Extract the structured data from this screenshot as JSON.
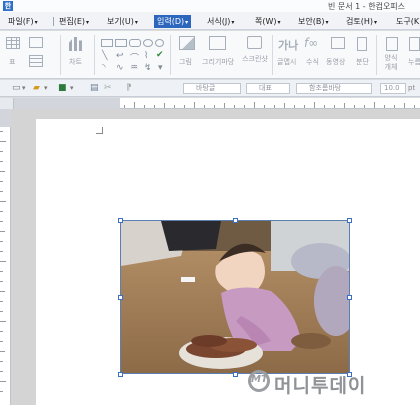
{
  "window": {
    "app_icon_glyph": "한",
    "title": "빈 문서 1 - 한컴오피스"
  },
  "menu": [
    {
      "label": "파일(F)",
      "active": false
    },
    {
      "label": "편집(E)",
      "active": false
    },
    {
      "label": "보기(U)",
      "active": false
    },
    {
      "label": "입력(D)",
      "active": true
    },
    {
      "label": "서식(J)",
      "active": false
    },
    {
      "label": "쪽(W)",
      "active": false
    },
    {
      "label": "보안(B)",
      "active": false
    },
    {
      "label": "검토(H)",
      "active": false
    },
    {
      "label": "도구(K)",
      "active": false
    }
  ],
  "ribbon": {
    "table_label": "표",
    "chart_label": "차트",
    "picture_label": "그림",
    "drawing_label": "그리기마당",
    "screenshot_label": "스크린샷",
    "glyph_label": "글맵시",
    "formula_label": "수식",
    "video_label": "동영상",
    "split_label": "분단",
    "form_label": "양식개체",
    "more_label": "누름",
    "glyph_icon": "가나",
    "formula_icon": "f∞"
  },
  "format_bar": {
    "style": "바탕글",
    "font_lang": "대표",
    "font": "함초롬바탕",
    "size": "10.0",
    "unit": "pt"
  },
  "icons": {
    "dropdown": "▾",
    "open_folder": "📂",
    "save": "💾",
    "print": "🖶"
  },
  "watermark": {
    "mark": "MT",
    "text": "머니투데이"
  }
}
